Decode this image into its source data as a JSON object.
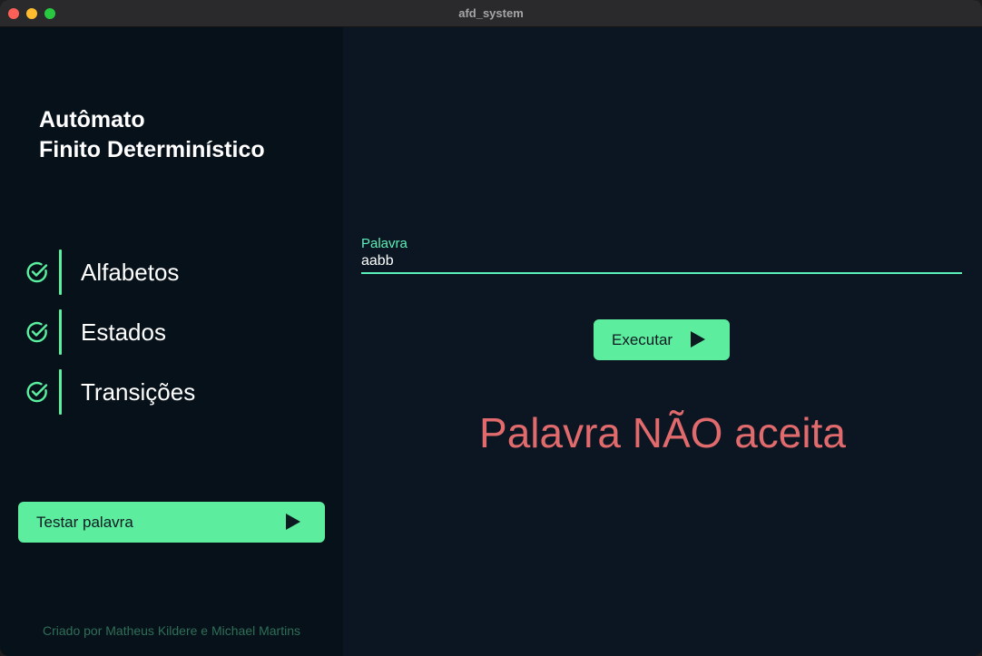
{
  "window": {
    "title": "afd_system"
  },
  "sidebar": {
    "title_line1": "Autômato",
    "title_line2": "Finito Determinístico",
    "steps": [
      {
        "label": "Alfabetos",
        "icon": "check-circle-icon",
        "done": true
      },
      {
        "label": "Estados",
        "icon": "check-circle-icon",
        "done": true
      },
      {
        "label": "Transições",
        "icon": "check-circle-icon",
        "done": true
      }
    ],
    "test_button_label": "Testar palavra",
    "footer": "Criado por Matheus Kildere e Michael Martins"
  },
  "main": {
    "word_field": {
      "label": "Palavra",
      "value": "aabb"
    },
    "execute_button_label": "Executar",
    "result_text": "Palavra NÃO aceita"
  },
  "colors": {
    "accent": "#5cee9e",
    "field_accent": "#5cf0b8",
    "result_rejected": "#e06a6c",
    "sidebar_bg": "#07111a",
    "main_bg": "#0b1622"
  }
}
